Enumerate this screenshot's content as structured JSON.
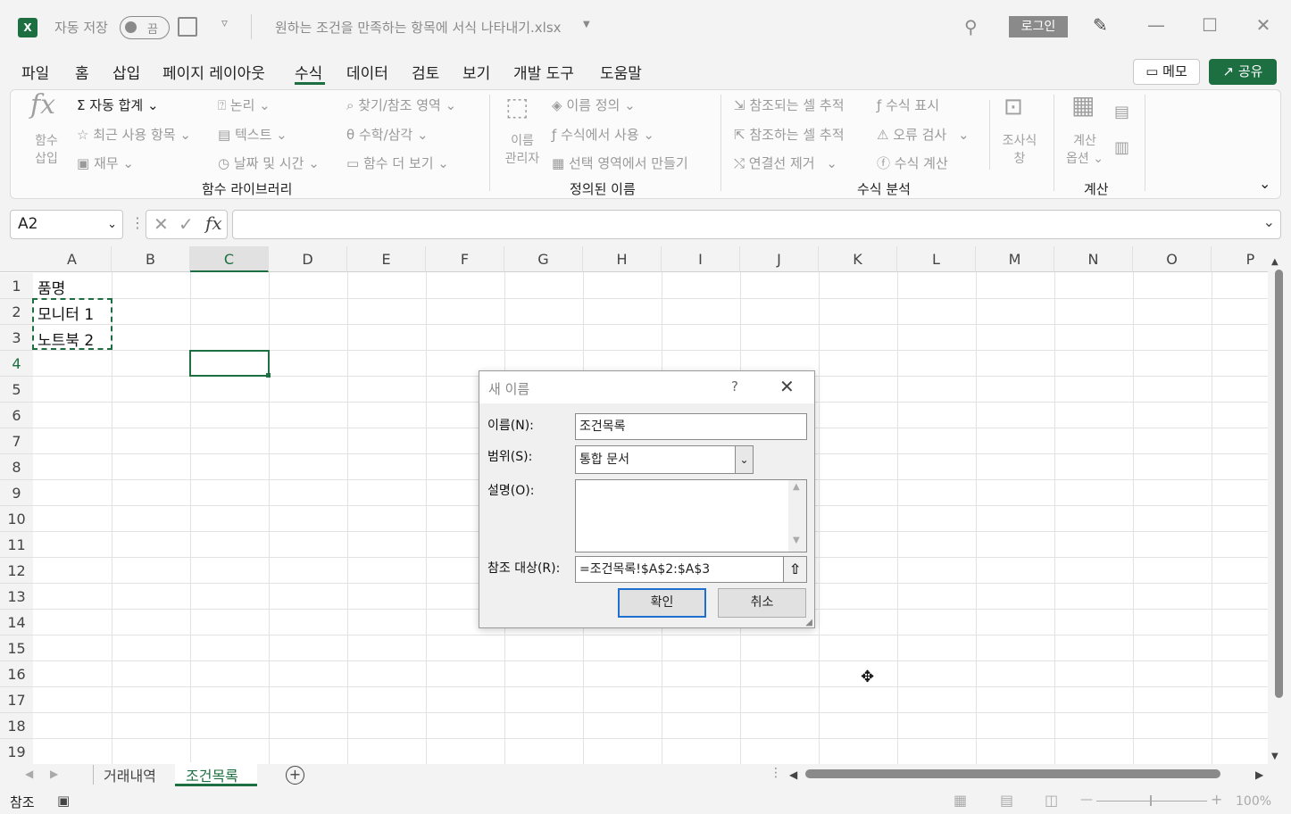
{
  "titlebar": {
    "app_icon": "X",
    "autosave_label": "자동 저장",
    "autosave_state": "끔",
    "filename": "원하는 조건을 만족하는 항목에 서식 나타내기.xlsx",
    "login_label": "로그인"
  },
  "menu": {
    "tabs": [
      "파일",
      "홈",
      "삽입",
      "페이지 레이아웃",
      "수식",
      "데이터",
      "검토",
      "보기",
      "개발 도구",
      "도움말"
    ],
    "active": "수식",
    "memo_label": "메모",
    "share_label": "공유"
  },
  "ribbon": {
    "insert_function": [
      "함수",
      "삽입"
    ],
    "autosum": "자동 합계",
    "recent": "최근 사용 항목",
    "financial": "재무",
    "logical": "논리",
    "text": "텍스트",
    "datetime": "날짜 및 시간",
    "lookup": "찾기/참조 영역",
    "math": "수학/삼각",
    "more_functions": "함수 더 보기",
    "function_library_group": "함수 라이브러리",
    "name_manager": [
      "이름",
      "관리자"
    ],
    "define_name": "이름 정의",
    "use_in_formula": "수식에서 사용",
    "create_from_selection": "선택 영역에서 만들기",
    "defined_names_group": "정의된 이름",
    "trace_precedents": "참조되는 셀 추적",
    "trace_dependents": "참조하는 셀 추적",
    "remove_arrows": "연결선 제거",
    "show_formulas": "수식 표시",
    "error_checking": "오류 검사",
    "evaluate_formula": "수식 계산",
    "watch_window": [
      "조사식",
      "창"
    ],
    "formula_auditing_group": "수식 분석",
    "calc_options": [
      "계산",
      "옵션"
    ],
    "calculation_group": "계산"
  },
  "formula_bar": {
    "name_box": "A2",
    "formula": ""
  },
  "grid": {
    "columns": [
      "A",
      "B",
      "C",
      "D",
      "E",
      "F",
      "G",
      "H",
      "I",
      "J",
      "K",
      "L",
      "M",
      "N",
      "O",
      "P"
    ],
    "rows": [
      "1",
      "2",
      "3",
      "4",
      "5",
      "6",
      "7",
      "8",
      "9",
      "10",
      "11",
      "12",
      "13",
      "14",
      "15",
      "16",
      "17",
      "18",
      "19"
    ],
    "a1": "품명",
    "a2": "모니터 1",
    "a3": "노트북 2"
  },
  "sheets": {
    "tabs": [
      "거래내역",
      "조건목록"
    ],
    "active": "조건목록"
  },
  "status": {
    "mode": "참조",
    "zoom": "100%"
  },
  "dialog": {
    "title": "새 이름",
    "help": "?",
    "name_label": "이름(N):",
    "name_value": "조건목록",
    "scope_label": "범위(S):",
    "scope_value": "통합 문서",
    "comment_label": "설명(O):",
    "comment_value": "",
    "refers_label": "참조 대상(R):",
    "refers_value": "=조건목록!$A$2:$A$3",
    "ok_label": "확인",
    "cancel_label": "취소"
  },
  "colors": {
    "accent": "#1d6f42",
    "primary_button_border": "#1e6fcf"
  }
}
